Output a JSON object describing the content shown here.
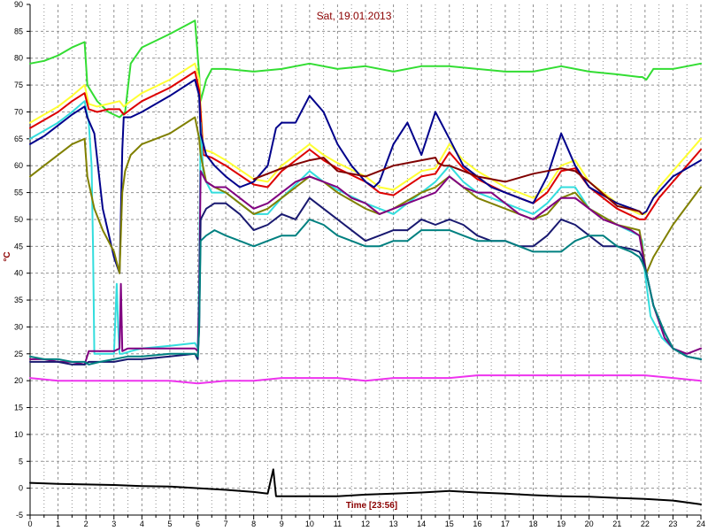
{
  "chart_data": {
    "type": "line",
    "title": "Sat, 19.01.2013",
    "xlabel": "Time [23:56]",
    "ylabel": "°C",
    "xlim": [
      0,
      24
    ],
    "ylim": [
      -5,
      90
    ],
    "xticks": [
      0,
      1,
      2,
      3,
      4,
      5,
      6,
      7,
      8,
      9,
      10,
      11,
      12,
      13,
      14,
      15,
      16,
      17,
      18,
      19,
      20,
      21,
      22,
      23,
      24
    ],
    "yticks": [
      -5,
      0,
      5,
      10,
      15,
      20,
      25,
      30,
      35,
      40,
      45,
      50,
      55,
      60,
      65,
      70,
      75,
      80,
      85,
      90
    ],
    "grid": true,
    "colors": {
      "background": "#ffffff",
      "grid": "#909090",
      "axis": "#000000",
      "title": "#8b0000"
    },
    "series": [
      {
        "color": "#33dd33",
        "x": [
          0,
          0.5,
          1,
          1.5,
          1.95,
          2.05,
          2.4,
          2.8,
          3.2,
          3.4,
          3.6,
          4,
          5,
          5.9,
          6.05,
          6.1,
          6.3,
          6.5,
          7,
          8,
          9,
          10,
          11,
          12,
          13,
          14,
          15,
          16,
          17,
          18,
          19,
          20,
          21,
          21.8,
          21.9,
          22.05,
          22.3,
          23,
          24
        ],
        "y": [
          79,
          79.5,
          80.5,
          82,
          83,
          75,
          72,
          70,
          69,
          70,
          79,
          82,
          84.5,
          87,
          77,
          72,
          76,
          78,
          78,
          77.5,
          78,
          79,
          78,
          78.5,
          77.5,
          78.5,
          78.5,
          78,
          77.5,
          77.5,
          78.5,
          77.5,
          77,
          76.5,
          76.5,
          76,
          78,
          78,
          79
        ]
      },
      {
        "color": "#ffff33",
        "x": [
          0,
          0.5,
          1,
          1.5,
          1.95,
          2.1,
          2.4,
          2.8,
          3.2,
          3.35,
          3.6,
          4,
          5,
          5.9,
          6.05,
          6.1,
          6.2,
          6.5,
          7,
          8,
          8.5,
          9,
          10,
          10.5,
          11,
          12,
          12.5,
          13,
          14,
          14.5,
          15,
          15.5,
          16,
          17,
          18,
          18.5,
          19,
          19.5,
          20,
          21,
          21.8,
          22,
          22.5,
          23,
          24
        ],
        "y": [
          68,
          69.5,
          71,
          73,
          75,
          71.5,
          71,
          71.5,
          72,
          71,
          72,
          73.5,
          76,
          79,
          76,
          71,
          63,
          62.5,
          61,
          57.5,
          57,
          60,
          64,
          62,
          60.5,
          58,
          56,
          55.5,
          59,
          59.5,
          64,
          61,
          59,
          56,
          54,
          56,
          60,
          61,
          57,
          53,
          51,
          51,
          56,
          59,
          65
        ]
      },
      {
        "color": "#dd0000",
        "x": [
          0,
          0.5,
          1,
          1.5,
          1.95,
          2.1,
          2.4,
          2.8,
          3.2,
          3.35,
          3.6,
          4,
          5,
          5.9,
          6.05,
          6.1,
          6.2,
          6.5,
          7,
          8,
          8.5,
          9,
          10,
          10.5,
          11,
          12,
          12.5,
          13,
          14,
          14.5,
          15,
          15.5,
          16,
          17,
          18,
          18.5,
          19,
          19.5,
          20,
          21,
          21.8,
          22,
          22.5,
          23,
          24
        ],
        "y": [
          67,
          68.5,
          70,
          72,
          73.5,
          70.5,
          70,
          70.5,
          70.5,
          69.5,
          70.5,
          72,
          74.5,
          77.5,
          74,
          70,
          62,
          61.5,
          60,
          56.5,
          56,
          59,
          63,
          61,
          59.5,
          57,
          55,
          54.5,
          58,
          58.5,
          62.5,
          59.5,
          57.5,
          55,
          53,
          55,
          59,
          59.5,
          56,
          52,
          50,
          50,
          54,
          57,
          63
        ]
      },
      {
        "color": "#33dddd",
        "x": [
          0,
          0.5,
          1,
          1.5,
          1.95,
          2.1,
          2.2,
          2.25,
          2.3,
          2.6,
          3,
          3.1,
          3.15,
          3.2,
          3.3,
          3.6,
          4,
          5,
          5.9,
          6.0,
          6.05,
          6.1,
          6.2,
          6.5,
          7,
          8,
          8.5,
          9,
          10,
          10.5,
          11,
          12,
          12.5,
          13,
          14,
          14.5,
          15,
          15.5,
          16,
          17,
          18,
          18.5,
          19,
          19.5,
          20,
          21,
          21.8,
          21.9,
          22,
          22.2,
          22.6,
          23,
          23.5,
          24
        ],
        "y": [
          65,
          66.5,
          68,
          70,
          72,
          68,
          60,
          45,
          25,
          25,
          25,
          38,
          30,
          25,
          25,
          25.5,
          26,
          26.5,
          27,
          26,
          40,
          68,
          58,
          55,
          55,
          51,
          51,
          54,
          59,
          57,
          55.5,
          53,
          52,
          51,
          55,
          57,
          60,
          57,
          55,
          53,
          51,
          53,
          56,
          56,
          52,
          49,
          47,
          46,
          40,
          32,
          28,
          26,
          24.5,
          24
        ]
      },
      {
        "color": "#00008b",
        "x": [
          0,
          0.5,
          1,
          1.5,
          1.95,
          2.05,
          2.3,
          2.6,
          3.0,
          3.2,
          3.3,
          3.35,
          3.6,
          4,
          5,
          5.9,
          6.05,
          6.1,
          6.3,
          6.6,
          7,
          7.5,
          8,
          8.5,
          8.8,
          9,
          9.5,
          10,
          10.5,
          11,
          11.5,
          12,
          12.3,
          12.5,
          13,
          13.5,
          14,
          14.5,
          15,
          15.5,
          16,
          16.5,
          17,
          17.5,
          18,
          18.5,
          19,
          19.5,
          20,
          21,
          21.8,
          21.9,
          22.05,
          22.3,
          23,
          24
        ],
        "y": [
          64,
          65.5,
          67.5,
          69.5,
          71,
          69,
          66,
          52,
          43,
          40,
          63,
          69,
          69,
          70,
          73,
          76,
          73,
          66,
          62,
          60,
          58,
          56,
          57,
          60,
          67,
          68,
          68,
          73,
          70,
          64,
          60,
          57,
          56,
          57,
          64,
          68,
          62,
          70,
          65,
          60,
          58,
          56,
          55,
          54,
          53,
          58,
          66,
          60,
          56,
          53,
          51.5,
          51,
          51.5,
          54,
          58,
          61
        ]
      },
      {
        "color": "#808000",
        "x": [
          0,
          0.5,
          1,
          1.5,
          1.95,
          2.05,
          2.3,
          2.6,
          3.0,
          3.2,
          3.3,
          3.4,
          3.6,
          4,
          5,
          5.9,
          6.05,
          6.1,
          6.3,
          6.6,
          7,
          8,
          8.5,
          9,
          10,
          10.5,
          11,
          12,
          12.5,
          13,
          14,
          14.5,
          15,
          15.5,
          16,
          17,
          18,
          18.5,
          19,
          19.5,
          20,
          21,
          21.8,
          21.9,
          22.05,
          22.3,
          23,
          24
        ],
        "y": [
          58,
          60,
          62,
          64,
          65,
          58,
          52,
          48,
          44,
          40,
          55,
          59,
          62,
          64,
          66,
          69,
          65,
          62,
          57,
          56,
          55,
          51,
          52,
          54,
          58,
          57,
          55,
          52,
          51,
          52,
          55,
          56,
          58,
          56,
          54,
          52,
          50,
          51,
          54,
          55,
          52,
          49,
          48,
          45,
          40,
          43,
          49,
          56
        ]
      },
      {
        "color": "#800080",
        "x": [
          0,
          0.5,
          1,
          1.5,
          1.95,
          2.1,
          2.5,
          3,
          3.2,
          3.25,
          3.3,
          3.5,
          4,
          5,
          5.9,
          6.0,
          6.05,
          6.1,
          6.3,
          6.6,
          7,
          7.5,
          8,
          8.5,
          9,
          9.5,
          10,
          10.5,
          11,
          11.5,
          12,
          12.5,
          13,
          13.5,
          14,
          14.5,
          15,
          15.5,
          16,
          16.5,
          17,
          17.5,
          18,
          18.5,
          19,
          19.5,
          20,
          20.5,
          21,
          21.5,
          21.8,
          21.9,
          22.05,
          22.3,
          22.7,
          23,
          23.5,
          24
        ],
        "y": [
          24,
          24,
          23.5,
          23.5,
          23,
          25.5,
          25.5,
          25.5,
          26,
          38,
          25.5,
          26,
          26,
          26,
          26,
          25.5,
          36,
          59,
          57,
          56,
          56,
          54,
          52,
          53,
          55,
          57,
          58,
          57,
          56,
          54,
          53,
          51,
          52,
          53,
          54,
          55,
          58,
          56,
          55,
          55,
          53,
          51,
          50,
          52,
          54,
          54,
          52,
          50,
          49,
          48,
          47,
          44,
          40,
          34,
          28,
          26,
          25,
          26
        ]
      },
      {
        "color": "#191970",
        "x": [
          0,
          0.5,
          1,
          1.5,
          1.95,
          2.1,
          2.5,
          3,
          3.5,
          4,
          5,
          5.9,
          6.0,
          6.05,
          6.1,
          6.3,
          6.6,
          7,
          7.5,
          8,
          8.5,
          9,
          9.5,
          10,
          10.5,
          11,
          11.5,
          12,
          12.5,
          13,
          13.5,
          14,
          14.5,
          15,
          15.5,
          16,
          16.5,
          17,
          17.5,
          18,
          18.5,
          19,
          19.5,
          20,
          20.5,
          21,
          21.5,
          21.8,
          21.9,
          22.05,
          22.3,
          22.7,
          23,
          23.5,
          24
        ],
        "y": [
          23.5,
          23.5,
          23.5,
          23,
          23,
          23.5,
          23.5,
          23.5,
          24,
          24,
          24.5,
          25,
          24,
          30,
          50,
          52,
          53,
          53,
          51,
          48,
          49,
          51,
          50,
          54,
          52,
          50,
          48,
          46,
          47,
          48,
          48,
          50,
          49,
          50,
          49,
          47,
          46,
          46,
          45,
          45,
          47,
          50,
          49,
          47,
          45,
          45,
          44.5,
          44,
          43,
          40,
          34,
          29,
          26,
          24.5,
          24
        ]
      },
      {
        "color": "#008080",
        "x": [
          0,
          0.5,
          1,
          1.5,
          1.95,
          2.1,
          2.5,
          3,
          3.5,
          4,
          5,
          5.9,
          6.0,
          6.05,
          6.1,
          6.3,
          6.6,
          7,
          7.5,
          8,
          8.5,
          9,
          9.5,
          10,
          10.5,
          11,
          11.5,
          12,
          12.5,
          13,
          13.5,
          14,
          14.5,
          15,
          15.5,
          16,
          16.5,
          17,
          17.5,
          18,
          18.5,
          19,
          19.5,
          20,
          20.5,
          21,
          21.5,
          21.8,
          21.9,
          22.05,
          22.3,
          22.7,
          23,
          23.5,
          24
        ],
        "y": [
          24.5,
          24,
          24,
          23.5,
          23.5,
          23,
          23.5,
          24,
          24.5,
          24.5,
          25,
          25,
          24.5,
          30,
          46,
          47,
          48,
          47,
          46,
          45,
          46,
          47,
          47,
          50,
          49,
          47,
          46,
          45,
          45,
          46,
          46,
          48,
          48,
          48,
          47,
          46,
          46,
          46,
          45,
          44,
          44,
          44,
          46,
          47,
          47,
          45,
          44,
          43,
          42,
          40,
          34,
          29,
          26,
          24.5,
          24
        ]
      },
      {
        "color": "#800000",
        "x": [
          8,
          9,
          10,
          10.5,
          11,
          12,
          13,
          14,
          14.5,
          14.6,
          14.8,
          15,
          16,
          17,
          18,
          19,
          19.5,
          20,
          21,
          21.8,
          21.9
        ],
        "y": [
          57.5,
          59.5,
          61,
          61.5,
          59,
          58,
          60,
          61,
          61.5,
          60.5,
          60,
          60,
          58,
          57,
          58.5,
          59.5,
          59,
          57,
          52.5,
          51.5,
          51
        ]
      },
      {
        "color": "#ee33ee",
        "x": [
          0,
          1,
          2,
          3,
          4,
          5,
          6,
          7,
          8,
          9,
          10,
          11,
          12,
          13,
          14,
          15,
          16,
          17,
          18,
          19,
          20,
          21,
          22,
          23,
          24
        ],
        "y": [
          20.5,
          20,
          20,
          20,
          20,
          20,
          19.5,
          20,
          20,
          20.5,
          20.5,
          20.5,
          20,
          20.5,
          20.5,
          20.5,
          21,
          21,
          21,
          21,
          21,
          21,
          21,
          20.5,
          20
        ]
      },
      {
        "color": "#000000",
        "x": [
          0,
          1,
          2,
          3,
          4,
          5,
          6,
          7,
          8,
          8.5,
          8.7,
          8.8,
          9,
          10,
          11,
          12,
          13,
          14,
          15,
          16,
          17,
          18,
          19,
          20,
          21,
          22,
          23,
          24
        ],
        "y": [
          1,
          0.8,
          0.7,
          0.6,
          0.4,
          0.3,
          0,
          -0.3,
          -0.7,
          -1,
          3.5,
          -1.5,
          -1.5,
          -1.5,
          -1.5,
          -1.2,
          -1,
          -0.8,
          -0.5,
          -0.8,
          -1,
          -1.3,
          -1.5,
          -1.6,
          -1.8,
          -2,
          -2.3,
          -3
        ]
      }
    ]
  }
}
